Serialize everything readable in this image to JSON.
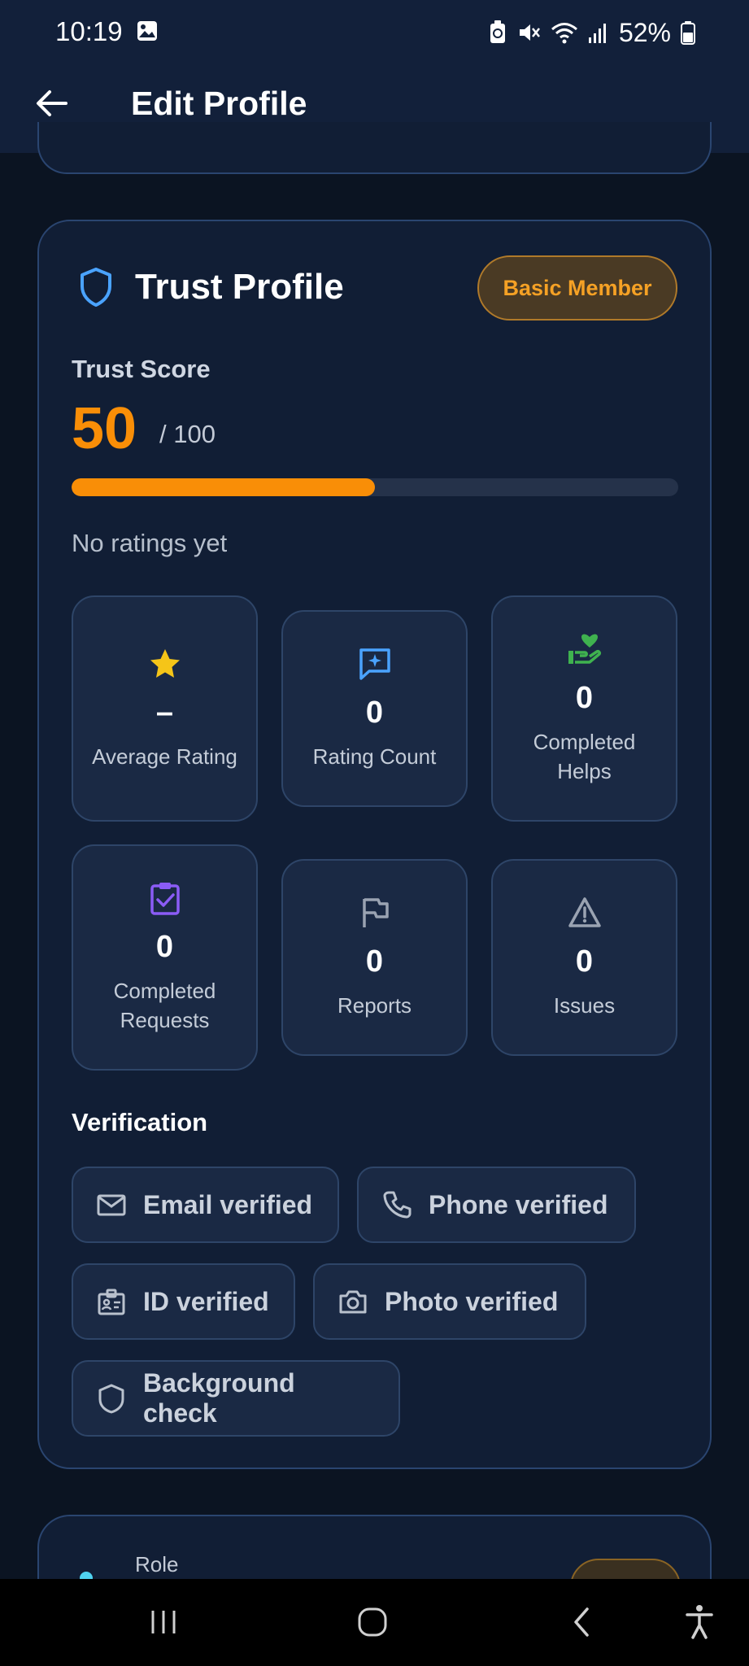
{
  "status_bar": {
    "time": "10:19",
    "battery": "52%"
  },
  "app_bar": {
    "title": "Edit Profile"
  },
  "trust_profile": {
    "title": "Trust Profile",
    "badge": "Basic Member",
    "score_label": "Trust Score",
    "score": "50",
    "score_max": "/ 100",
    "score_progress_percent": 50,
    "ratings_note": "No ratings yet",
    "stats": [
      {
        "icon": "star-icon",
        "value": "–",
        "label": "Average Rating",
        "color": "#f5c518"
      },
      {
        "icon": "chat-sparkle-icon",
        "value": "0",
        "label": "Rating Count",
        "color": "#4aa3ff"
      },
      {
        "icon": "hand-heart-icon",
        "value": "0",
        "label": "Completed Helps",
        "color": "#3fb24f"
      },
      {
        "icon": "clipboard-check-icon",
        "value": "0",
        "label": "Completed Requests",
        "color": "#8b5cf6"
      },
      {
        "icon": "flag-icon",
        "value": "0",
        "label": "Reports",
        "color": "#9aa3b2"
      },
      {
        "icon": "warning-icon",
        "value": "0",
        "label": "Issues",
        "color": "#9aa3b2"
      }
    ],
    "verification_title": "Verification",
    "verifications": [
      {
        "icon": "mail-icon",
        "label": "Email verified"
      },
      {
        "icon": "phone-icon",
        "label": "Phone verified"
      },
      {
        "icon": "id-card-icon",
        "label": "ID verified"
      },
      {
        "icon": "camera-icon",
        "label": "Photo verified"
      },
      {
        "icon": "shield-icon",
        "label": "Background check"
      }
    ]
  },
  "next_section": {
    "label": "Role"
  },
  "colors": {
    "accent_orange": "#f98e07",
    "card_bg": "#111e35",
    "page_bg": "#0b1422"
  }
}
